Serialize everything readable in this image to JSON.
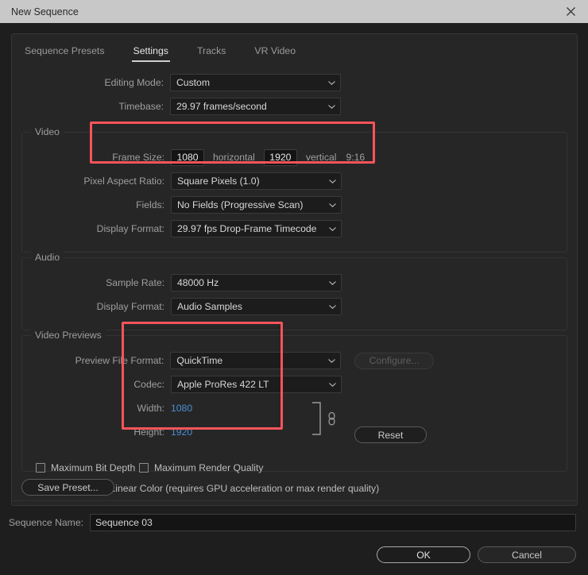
{
  "window": {
    "title": "New Sequence",
    "close_icon": "close-icon"
  },
  "tabs": [
    {
      "label": "Sequence Presets",
      "active": false
    },
    {
      "label": "Settings",
      "active": true
    },
    {
      "label": "Tracks",
      "active": false
    },
    {
      "label": "VR Video",
      "active": false
    }
  ],
  "settings": {
    "editing_mode": {
      "label": "Editing Mode:",
      "value": "Custom"
    },
    "timebase": {
      "label": "Timebase:",
      "value": "29.97  frames/second"
    }
  },
  "video": {
    "group_label": "Video",
    "frame_size": {
      "label": "Frame Size:",
      "width": "1080",
      "width_unit": "horizontal",
      "height": "1920",
      "height_unit": "vertical",
      "aspect": "9:16"
    },
    "pixel_aspect_ratio": {
      "label": "Pixel Aspect Ratio:",
      "value": "Square Pixels (1.0)"
    },
    "fields": {
      "label": "Fields:",
      "value": "No Fields (Progressive Scan)"
    },
    "display_format": {
      "label": "Display Format:",
      "value": "29.97 fps Drop-Frame Timecode"
    }
  },
  "audio": {
    "group_label": "Audio",
    "sample_rate": {
      "label": "Sample Rate:",
      "value": "48000 Hz"
    },
    "display_format": {
      "label": "Display Format:",
      "value": "Audio Samples"
    }
  },
  "video_previews": {
    "group_label": "Video Previews",
    "preview_file_format": {
      "label": "Preview File Format:",
      "value": "QuickTime"
    },
    "codec": {
      "label": "Codec:",
      "value": "Apple ProRes 422 LT"
    },
    "width": {
      "label": "Width:",
      "value": "1080"
    },
    "height": {
      "label": "Height:",
      "value": "1920"
    },
    "configure_button": "Configure...",
    "reset_button": "Reset",
    "link_icon": "link-chain-icon"
  },
  "options": {
    "maximum_bit_depth": {
      "label": "Maximum Bit Depth",
      "checked": false
    },
    "maximum_render_quality": {
      "label": "Maximum Render Quality",
      "checked": false
    },
    "composite_linear_color": {
      "label": "Composite in Linear Color (requires GPU acceleration or max render quality)",
      "checked": true
    }
  },
  "save_preset_button": "Save Preset...",
  "footer": {
    "sequence_name_label": "Sequence Name:",
    "sequence_name_value": "Sequence 03",
    "ok_button": "OK",
    "cancel_button": "Cancel"
  },
  "highlights": {
    "frame_size_color": "#f8545a",
    "preview_color": "#f8545a"
  }
}
